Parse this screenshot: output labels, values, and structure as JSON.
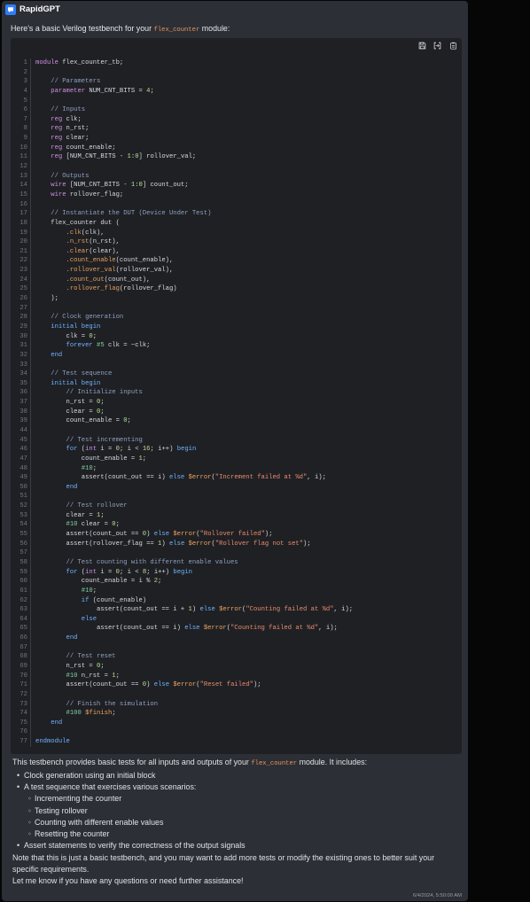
{
  "app": {
    "name": "RapidGPT",
    "logo_icon": "rapidgpt-logo-icon"
  },
  "theme": {
    "brand": "#2f7df6",
    "inline_code": "#e8955e"
  },
  "message": {
    "intro": {
      "before": "Here's a basic Verilog testbench for your ",
      "code": "flex_counter",
      "after": " module:"
    },
    "code_block": {
      "toolbar": [
        {
          "icon": "save-icon"
        },
        {
          "icon": "insert-code-icon"
        },
        {
          "icon": "copy-icon"
        }
      ],
      "lines": [
        {
          "num": 1,
          "text": "module flex_counter_tb;"
        },
        {
          "num": 2,
          "text": ""
        },
        {
          "num": 3,
          "text": "    // Parameters"
        },
        {
          "num": 4,
          "text": "    parameter NUM_CNT_BITS = 4;"
        },
        {
          "num": 5,
          "text": ""
        },
        {
          "num": 6,
          "text": "    // Inputs"
        },
        {
          "num": 7,
          "text": "    reg clk;"
        },
        {
          "num": 8,
          "text": "    reg n_rst;"
        },
        {
          "num": 9,
          "text": "    reg clear;"
        },
        {
          "num": 10,
          "text": "    reg count_enable;"
        },
        {
          "num": 11,
          "text": "    reg [NUM_CNT_BITS - 1:0] rollover_val;"
        },
        {
          "num": 12,
          "text": ""
        },
        {
          "num": 13,
          "text": "    // Outputs"
        },
        {
          "num": 14,
          "text": "    wire [NUM_CNT_BITS - 1:0] count_out;"
        },
        {
          "num": 15,
          "text": "    wire rollover_flag;"
        },
        {
          "num": 16,
          "text": ""
        },
        {
          "num": 17,
          "text": "    // Instantiate the DUT (Device Under Test)"
        },
        {
          "num": 18,
          "text": "    flex_counter dut ("
        },
        {
          "num": 19,
          "text": "        .clk(clk),"
        },
        {
          "num": 20,
          "text": "        .n_rst(n_rst),"
        },
        {
          "num": 21,
          "text": "        .clear(clear),"
        },
        {
          "num": 22,
          "text": "        .count_enable(count_enable),"
        },
        {
          "num": 23,
          "text": "        .rollover_val(rollover_val),"
        },
        {
          "num": 24,
          "text": "        .count_out(count_out),"
        },
        {
          "num": 25,
          "text": "        .rollover_flag(rollover_flag)"
        },
        {
          "num": 26,
          "text": "    );"
        },
        {
          "num": 27,
          "text": ""
        },
        {
          "num": 28,
          "text": "    // Clock generation"
        },
        {
          "num": 29,
          "text": "    initial begin"
        },
        {
          "num": 30,
          "text": "        clk = 0;"
        },
        {
          "num": 31,
          "text": "        forever #5 clk = ~clk;"
        },
        {
          "num": 32,
          "text": "    end"
        },
        {
          "num": 33,
          "text": ""
        },
        {
          "num": 34,
          "text": "    // Test sequence"
        },
        {
          "num": 35,
          "text": "    initial begin"
        },
        {
          "num": 36,
          "text": "        // Initialize inputs"
        },
        {
          "num": 37,
          "text": "        n_rst = 0;"
        },
        {
          "num": 38,
          "text": "        clear = 0;"
        },
        {
          "num": 39,
          "text": "        count_enable = 0;"
        },
        {
          "num": 44,
          "text": ""
        },
        {
          "num": 45,
          "text": "        // Test incrementing"
        },
        {
          "num": 46,
          "text": "        for (int i = 0; i < 16; i++) begin"
        },
        {
          "num": 47,
          "text": "            count_enable = 1;"
        },
        {
          "num": 48,
          "text": "            #10;"
        },
        {
          "num": 49,
          "text": "            assert(count_out == i) else $error(\"Increment failed at %d\", i);"
        },
        {
          "num": 50,
          "text": "        end"
        },
        {
          "num": 51,
          "text": ""
        },
        {
          "num": 52,
          "text": "        // Test rollover"
        },
        {
          "num": 53,
          "text": "        clear = 1;"
        },
        {
          "num": 54,
          "text": "        #10 clear = 0;"
        },
        {
          "num": 55,
          "text": "        assert(count_out == 0) else $error(\"Rollover failed\");"
        },
        {
          "num": 56,
          "text": "        assert(rollover_flag == 1) else $error(\"Rollover flag not set\");"
        },
        {
          "num": 57,
          "text": ""
        },
        {
          "num": 58,
          "text": "        // Test counting with different enable values"
        },
        {
          "num": 59,
          "text": "        for (int i = 0; i < 8; i++) begin"
        },
        {
          "num": 60,
          "text": "            count_enable = i % 2;"
        },
        {
          "num": 61,
          "text": "            #10;"
        },
        {
          "num": 62,
          "text": "            if (count_enable)"
        },
        {
          "num": 63,
          "text": "                assert(count_out == i + 1) else $error(\"Counting failed at %d\", i);"
        },
        {
          "num": 64,
          "text": "            else"
        },
        {
          "num": 65,
          "text": "                assert(count_out == i) else $error(\"Counting failed at %d\", i);"
        },
        {
          "num": 66,
          "text": "        end"
        },
        {
          "num": 67,
          "text": ""
        },
        {
          "num": 68,
          "text": "        // Test reset"
        },
        {
          "num": 69,
          "text": "        n_rst = 0;"
        },
        {
          "num": 70,
          "text": "        #10 n_rst = 1;"
        },
        {
          "num": 71,
          "text": "        assert(count_out == 0) else $error(\"Reset failed\");"
        },
        {
          "num": 72,
          "text": ""
        },
        {
          "num": 73,
          "text": "        // Finish the simulation"
        },
        {
          "num": 74,
          "text": "        #100 $finish;"
        },
        {
          "num": 75,
          "text": "    end"
        },
        {
          "num": 76,
          "text": ""
        },
        {
          "num": 77,
          "text": "endmodule"
        }
      ]
    },
    "summary": {
      "before": "This testbench provides basic tests for all inputs and outputs of your ",
      "code": "flex_counter",
      "after": " module. It includes:"
    },
    "bullets": [
      {
        "text": "Clock generation using an initial block"
      },
      {
        "text": "A test sequence that exercises various scenarios:",
        "children": [
          "Incrementing the counter",
          "Testing rollover",
          "Counting with different enable values",
          "Resetting the counter"
        ]
      },
      {
        "text": "Assert statements to verify the correctness of the output signals"
      }
    ],
    "note": "Note that this is just a basic testbench, and you may want to add more tests or modify the existing ones to better suit your specific requirements.",
    "closing": "Let me know if you have any questions or need further assistance!",
    "timestamp": "6/4/2024, 5:50:00 AM"
  }
}
